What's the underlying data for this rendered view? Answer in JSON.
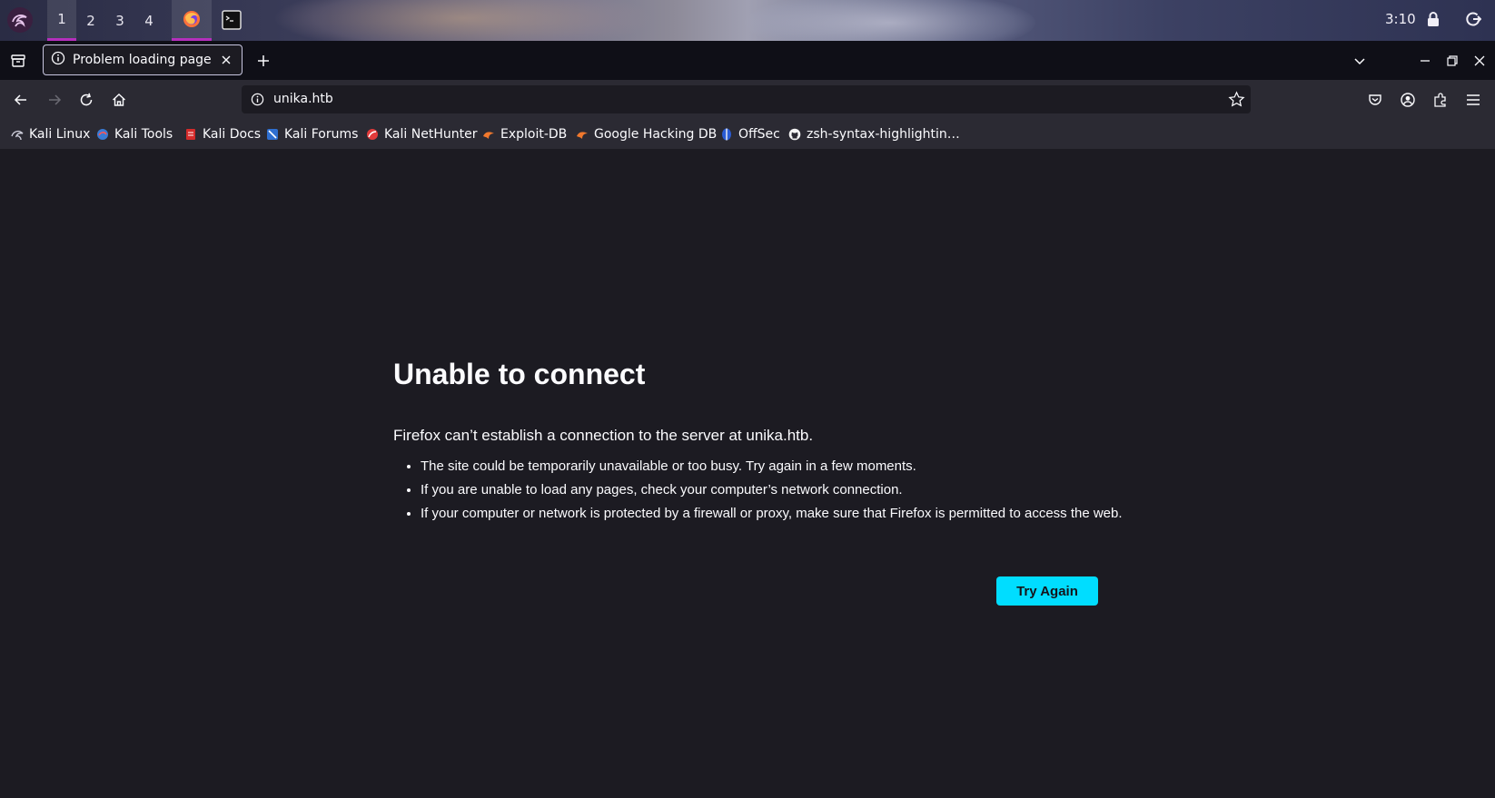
{
  "desktop_panel": {
    "workspaces": [
      "1",
      "2",
      "3",
      "4"
    ],
    "active_workspace": "1",
    "clock": "3:10",
    "accent_color": "#b52fbd"
  },
  "browser": {
    "tab": {
      "title": "Problem loading page"
    },
    "url": "unika.htb",
    "bookmarks": [
      "Kali Linux",
      "Kali Tools",
      "Kali Docs",
      "Kali Forums",
      "Kali NetHunter",
      "Exploit-DB",
      "Google Hacking DB",
      "OffSec",
      "zsh-syntax-highlightin…"
    ]
  },
  "error_page": {
    "title": "Unable to connect",
    "description": "Firefox can’t establish a connection to the server at unika.htb.",
    "bullets": [
      "The site could be temporarily unavailable or too busy. Try again in a few moments.",
      "If you are unable to load any pages, check your computer’s network connection.",
      "If your computer or network is protected by a firewall or proxy, make sure that Firefox is permitted to access the web."
    ],
    "button_label": "Try Again",
    "button_color": "#00ddff"
  }
}
